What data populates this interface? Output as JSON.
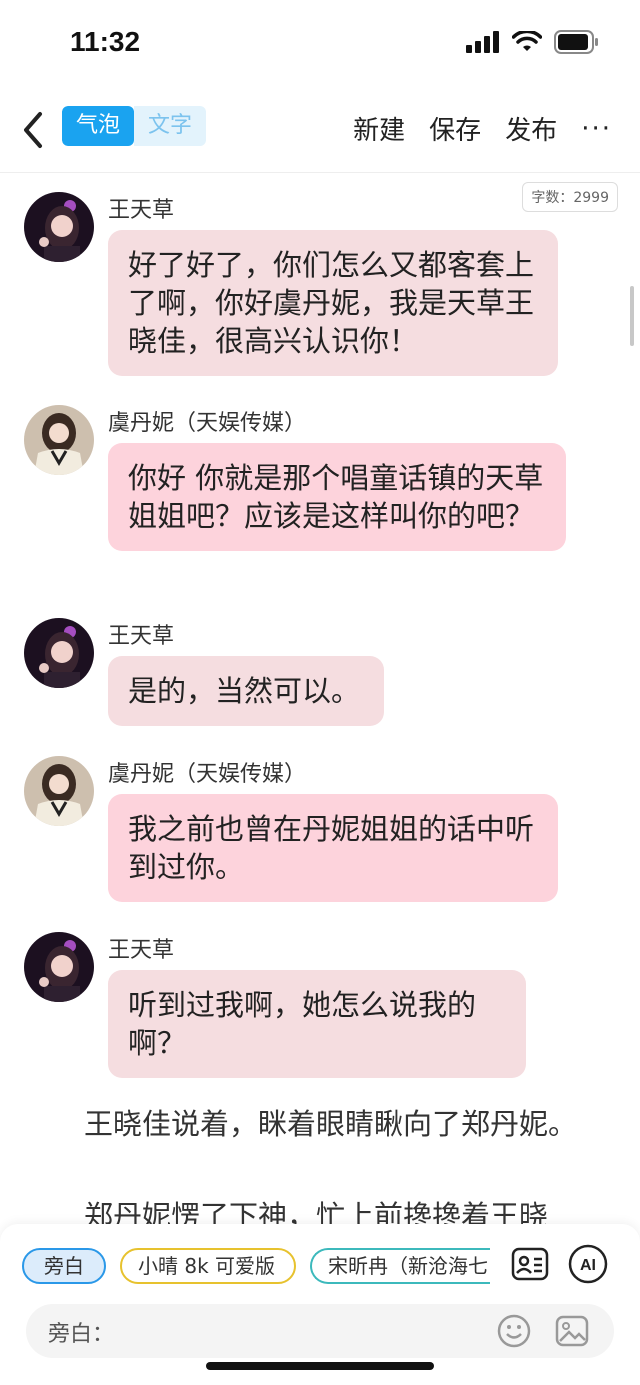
{
  "status": {
    "time": "11:32"
  },
  "nav": {
    "tab_bubble": "气泡",
    "tab_text": "文字",
    "new": "新建",
    "save": "保存",
    "publish": "发布",
    "more": "···"
  },
  "word_count": "字数：2999",
  "messages": [
    {
      "name": "王天草",
      "text": "好了好了，你们怎么又都客套上了啊，你好虞丹妮，我是天草王晓佳，很高兴认识你！"
    },
    {
      "name": "虞丹妮（天娱传媒）",
      "text": "你好 你就是那个唱童话镇的天草姐姐吧？应该是这样叫你的吧？"
    },
    {
      "name": "王天草",
      "text": "是的，当然可以。"
    },
    {
      "name": "虞丹妮（天娱传媒）",
      "text": "我之前也曾在丹妮姐姐的话中听到过你。"
    },
    {
      "name": "王天草",
      "text": "听到过我啊，她怎么说我的啊？"
    }
  ],
  "narration": [
    "王晓佳说着，眯着眼睛瞅向了郑丹妮。",
    "郑丹妮愣了下神，忙上前搀搀着王晓"
  ],
  "bottom": {
    "chips": [
      "旁白",
      "小晴 8k 可爱版",
      "宋昕冉（新沧海七"
    ],
    "input_label": "旁白："
  },
  "colors": {
    "accent": "#1aa3f0",
    "bubble_grey": "#f5dde0",
    "bubble_pink": "#fdd3dc"
  }
}
